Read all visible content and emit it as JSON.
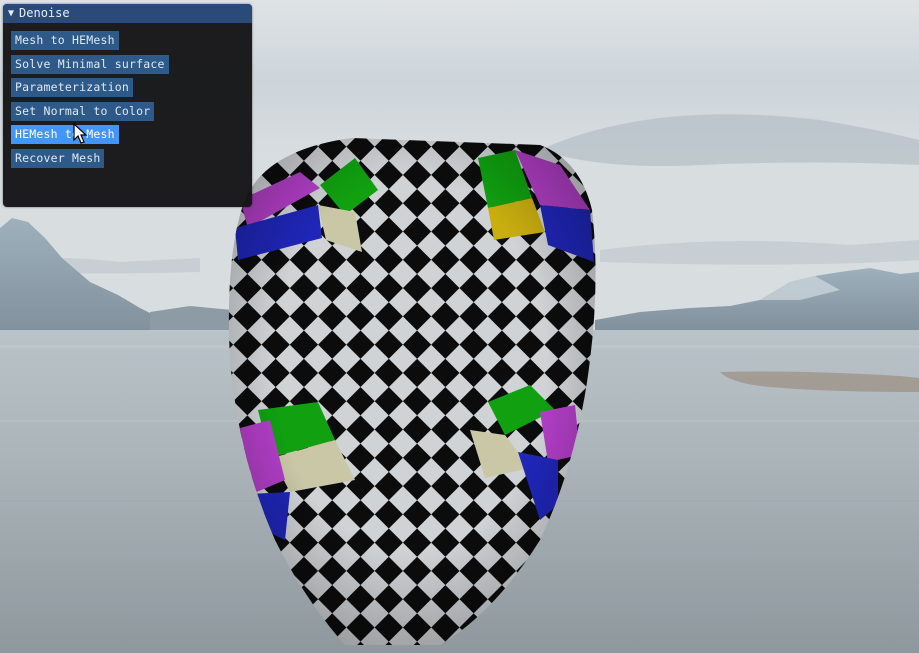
{
  "window": {
    "title": "Denoise",
    "collapse_glyph": "▼"
  },
  "buttons": [
    {
      "label": "Mesh to HEMesh"
    },
    {
      "label": "Solve Minimal surface"
    },
    {
      "label": "Parameterization"
    },
    {
      "label": "Set Normal to Color"
    },
    {
      "label": "HEMesh to Mesh",
      "state": "hovered"
    },
    {
      "label": "Recover Mesh"
    }
  ],
  "scene": {
    "background": "lake-mountain-skybox",
    "object": "face-mesh-checkerboard-texture"
  },
  "colors": {
    "titlebar": "#2a4a7a",
    "button": "#2e5a8a",
    "button_hover": "#4296fa",
    "panel_bg": "#141416"
  }
}
